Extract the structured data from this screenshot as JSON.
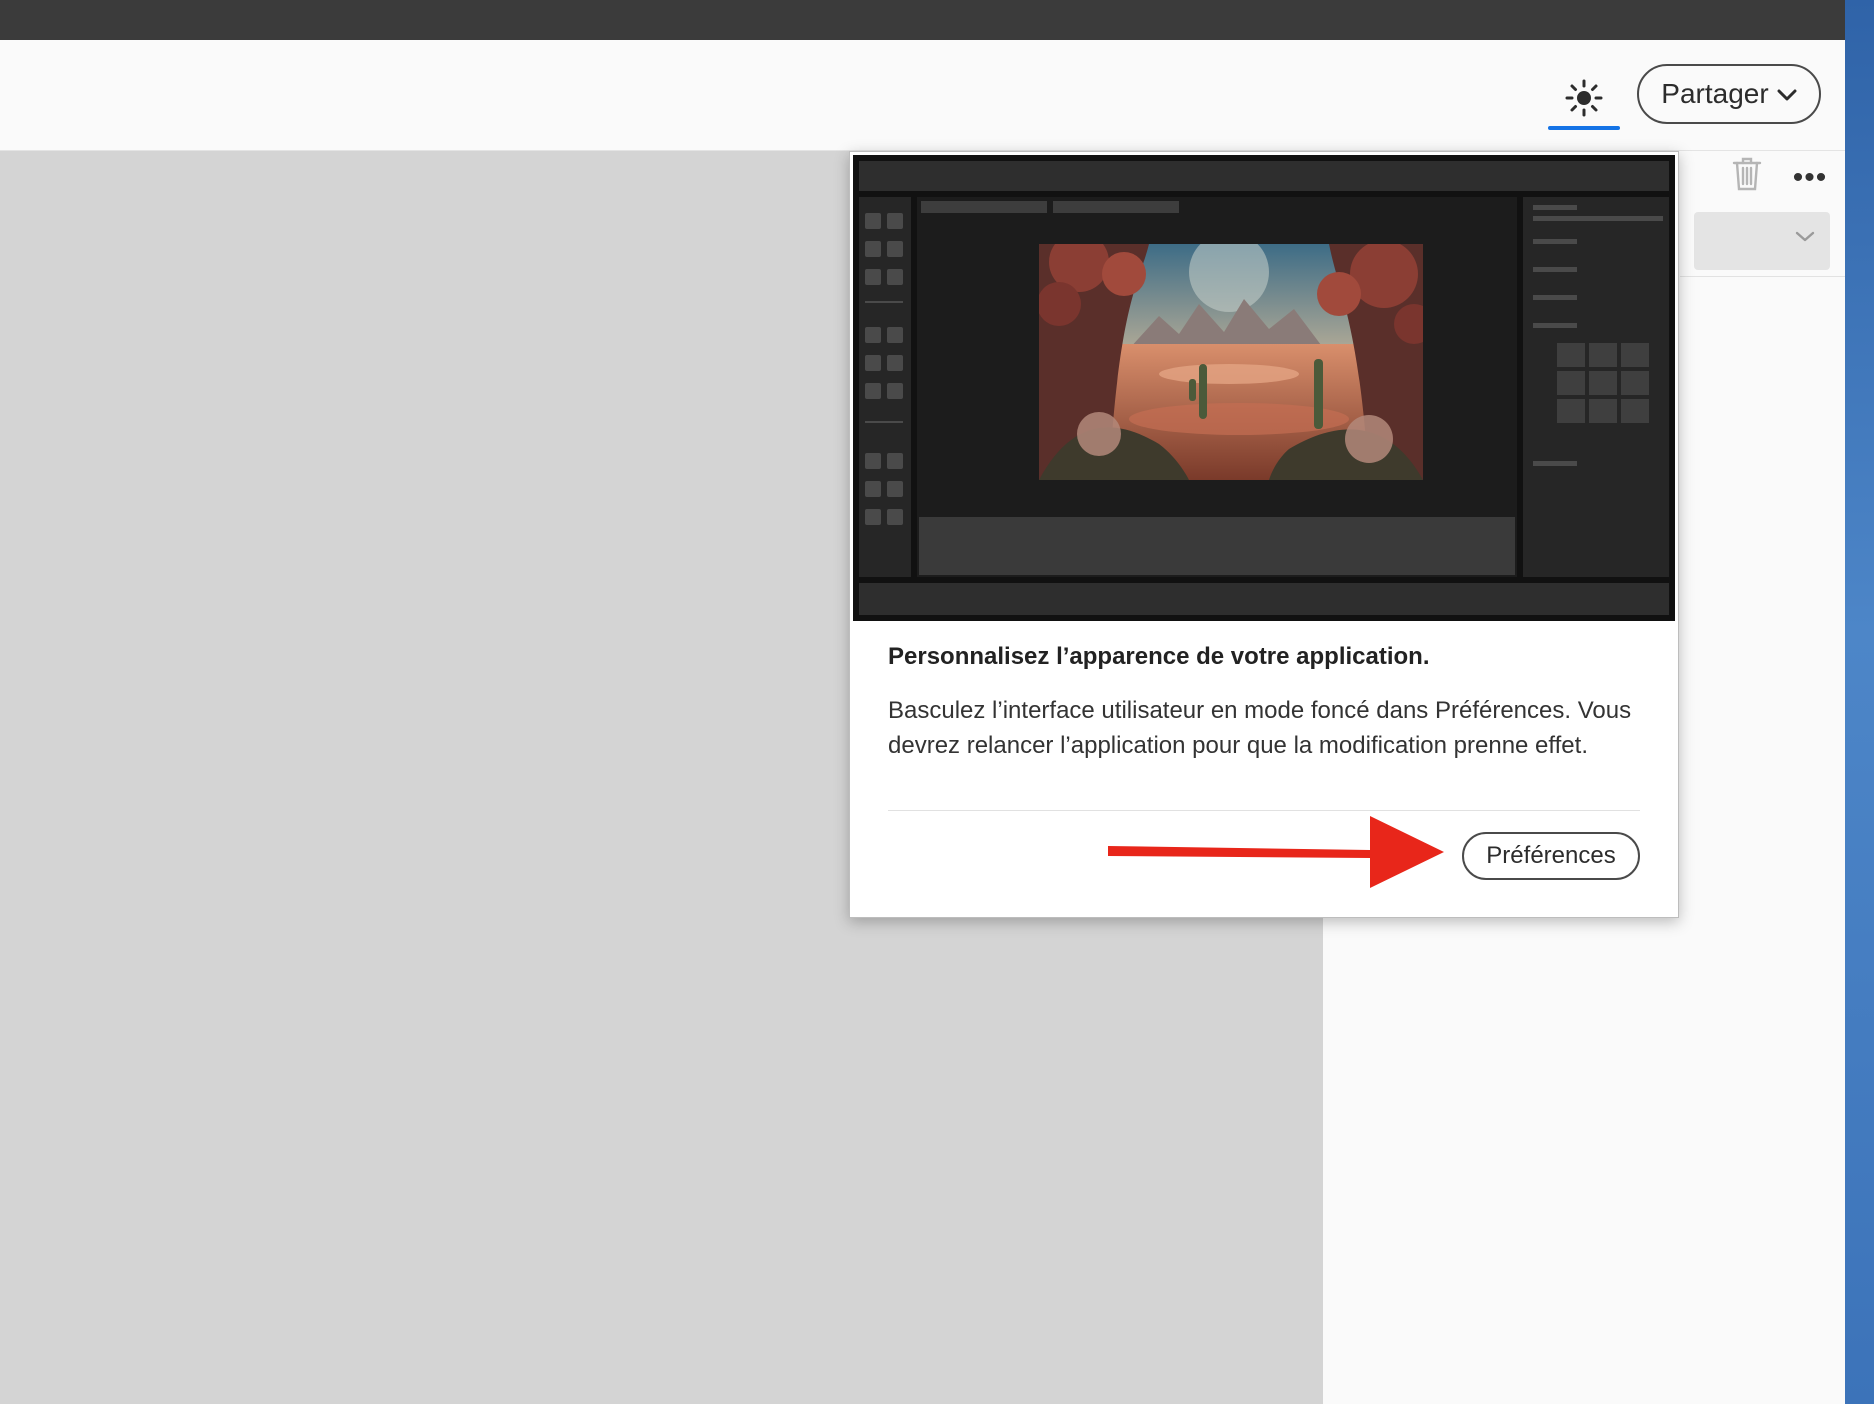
{
  "toolbar": {
    "theme_icon": "sun-icon",
    "share_label": "Partager",
    "share_icon": "chevron-down-icon"
  },
  "right_panel": {
    "trash_icon": "trash-icon",
    "more_label": "•••",
    "dropdown_icon": "chevron-down-icon"
  },
  "popover": {
    "preview_image": "dark-mode-app-preview",
    "title": "Personnalisez l’apparence de votre application.",
    "description": "Basculez l’interface utilisateur en mode foncé dans Préférences. Vous devrez relancer l’application pour que la modification prenne effet.",
    "button_label": "Préférences"
  },
  "annotation": {
    "arrow_color": "#e8261a"
  },
  "colors": {
    "accent": "#1473e6",
    "titlebar": "#3b3b3b",
    "canvas": "#d4d4d4"
  }
}
